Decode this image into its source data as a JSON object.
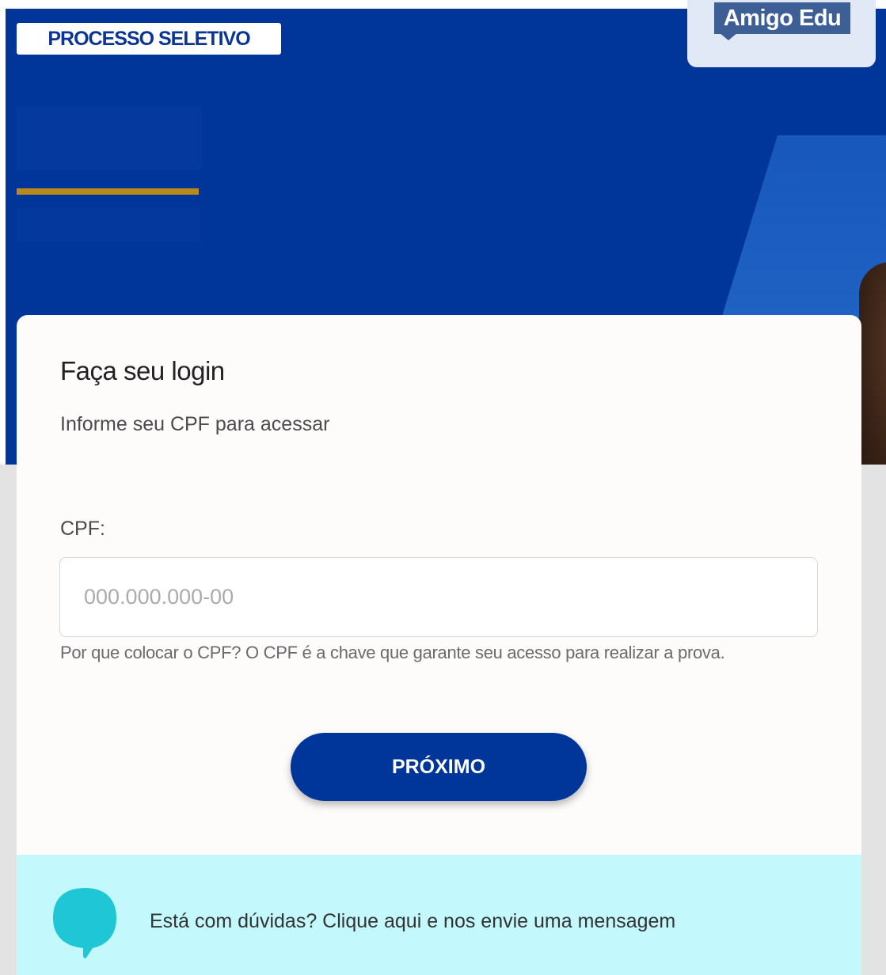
{
  "header": {
    "badge": "PROCESSO SELETIVO",
    "logo": "Amigo Edu"
  },
  "login": {
    "title": "Faça seu login",
    "subtitle": "Informe seu CPF para acessar",
    "cpf_label": "CPF:",
    "cpf_placeholder": "000.000.000-00",
    "cpf_value": "",
    "help_text": "Por que colocar o CPF? O CPF é a chave que garante seu acesso para realizar a prova.",
    "next_button": "PRÓXIMO"
  },
  "support": {
    "icon": "chat-bubble-icon",
    "link_text": "Está com dúvidas? Clique aqui e nos envie uma mensagem"
  },
  "colors": {
    "primary": "#00359a",
    "accent_gold": "#b88a1b",
    "support_bg": "#c3f8fc",
    "chat_icon": "#1fc6d6"
  }
}
